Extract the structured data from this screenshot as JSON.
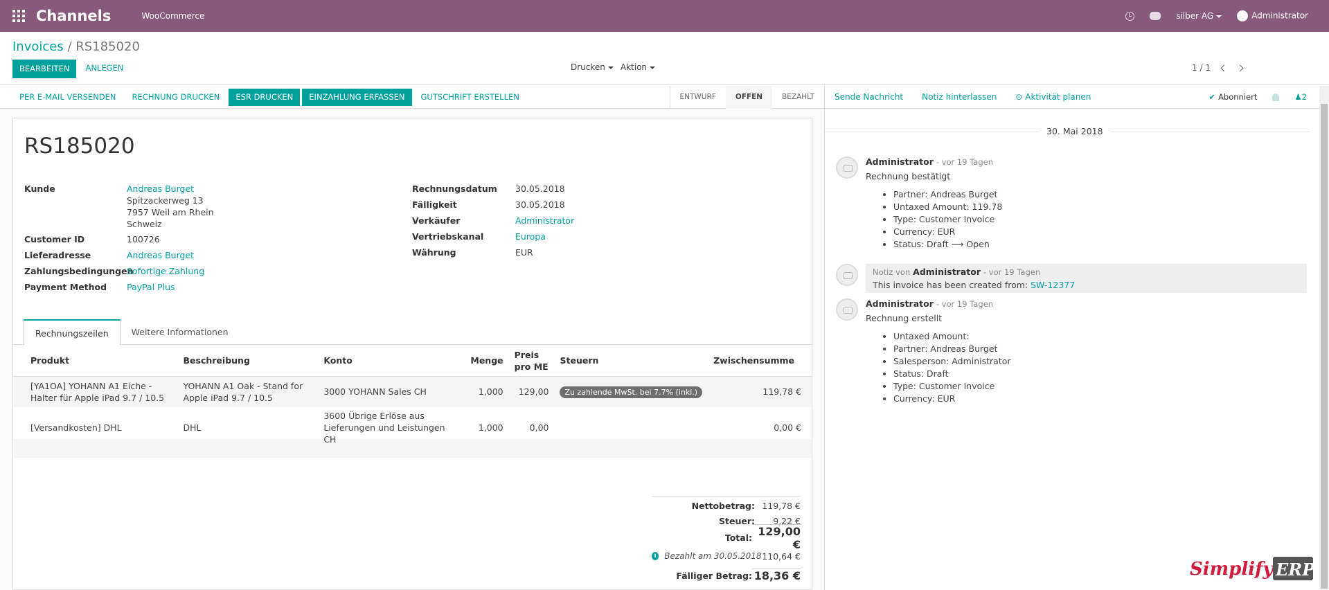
{
  "topbar": {
    "app_name": "Channels",
    "menu_item": "WooCommerce",
    "company": "silber AG",
    "user": "Administrator"
  },
  "breadcrumb": {
    "root": "Invoices",
    "separator": "/",
    "current": "RS185020"
  },
  "control": {
    "edit_label": "BEARBEITEN",
    "create_label": "ANLEGEN",
    "print_label": "Drucken",
    "action_label": "Aktion",
    "pager": "1 / 1"
  },
  "statusbar": {
    "buttons": [
      "PER E-MAIL VERSENDEN",
      "RECHNUNG DRUCKEN",
      "ESR DRUCKEN",
      "EINZAHLUNG ERFASSEN",
      "GUTSCHRIFT ERSTELLEN"
    ],
    "stages": [
      "ENTWURF",
      "OFFEN",
      "BEZAHLT"
    ],
    "active_stage": "OFFEN"
  },
  "invoice": {
    "number": "RS185020",
    "left_fields": {
      "customer_label": "Kunde",
      "customer_name": "Andreas Burget",
      "customer_addr1": "Spitzackerweg 13",
      "customer_addr2": "7957 Weil am Rhein",
      "customer_addr3": "Schweiz",
      "customer_id_label": "Customer ID",
      "customer_id": "100726",
      "delivery_label": "Lieferadresse",
      "delivery": "Andreas Burget",
      "terms_label": "Zahlungsbedingungen",
      "terms": "Sofortige Zahlung",
      "payment_label": "Payment Method",
      "payment": "PayPal Plus"
    },
    "right_fields": {
      "date_label": "Rechnungsdatum",
      "date": "30.05.2018",
      "due_label": "Fälligkeit",
      "due": "30.05.2018",
      "seller_label": "Verkäufer",
      "seller": "Administrator",
      "channel_label": "Vertriebskanal",
      "channel": "Europa",
      "currency_label": "Währung",
      "currency": "EUR"
    },
    "tabs": [
      "Rechnungszeilen",
      "Weitere Informationen"
    ],
    "columns": {
      "product": "Produkt",
      "description": "Beschreibung",
      "account": "Konto",
      "qty": "Menge",
      "price1": "Preis",
      "price2": "pro ME",
      "taxes": "Steuern",
      "subtotal": "Zwischensumme"
    },
    "lines": [
      {
        "product": "[YA1OA] YOHANN A1 Eiche - Halter für Apple iPad 9.7 / 10.5",
        "description": "YOHANN A1  Oak - Stand for Apple iPad 9.7 / 10.5",
        "account": "3000 YOHANN Sales CH",
        "qty": "1,000",
        "price": "129,00",
        "tax": "Zu zahlende MwSt. bei 7.7% (inkl.)",
        "subtotal": "119,78 €"
      },
      {
        "product": "[Versandkosten] DHL",
        "description": "DHL",
        "account": "3600 Übrige Erlöse aus Lieferungen und Leistungen CH",
        "qty": "1,000",
        "price": "0,00",
        "tax": "",
        "subtotal": "0,00 €"
      }
    ],
    "totals": {
      "net_label": "Nettobetrag:",
      "net": "119,78 €",
      "tax_label": "Steuer:",
      "tax": "9,22 €",
      "total_label": "Total:",
      "total": "129,00 €",
      "paid_label": "Bezahlt am 30.05.2018",
      "paid": "110,64 €",
      "due_label": "Fälliger Betrag:",
      "due": "18,36 €"
    }
  },
  "chatter": {
    "send_message": "Sende Nachricht",
    "log_note": "Notiz hinterlassen",
    "schedule": "Aktivität planen",
    "subscribed": "Abonniert",
    "followers": "2",
    "date": "30. Mai 2018",
    "msg1": {
      "author": "Administrator",
      "time": "- vor 19 Tagen",
      "text": "Rechnung bestätigt",
      "items": [
        "Partner: Andreas Burget",
        "Untaxed Amount: 119.78",
        "Type: Customer Invoice",
        "Currency: EUR",
        "Status: Draft ⟶ Open"
      ]
    },
    "msg2": {
      "prefix": "Notiz von",
      "author": "Administrator",
      "time": "- vor 19 Tagen",
      "text": "This invoice has been created from:",
      "link": "SW-12377"
    },
    "msg3": {
      "author": "Administrator",
      "time": "- vor 19 Tagen",
      "text": "Rechnung erstellt",
      "items": [
        "Untaxed Amount:",
        "Partner: Andreas Burget",
        "Salesperson: Administrator",
        "Status: Draft",
        "Type: Customer Invoice",
        "Currency: EUR"
      ]
    }
  },
  "watermark": {
    "part1": "Simplify",
    "part2": "ERP"
  },
  "colors": {
    "brand": "#875A7B",
    "accent": "#00A09D"
  }
}
